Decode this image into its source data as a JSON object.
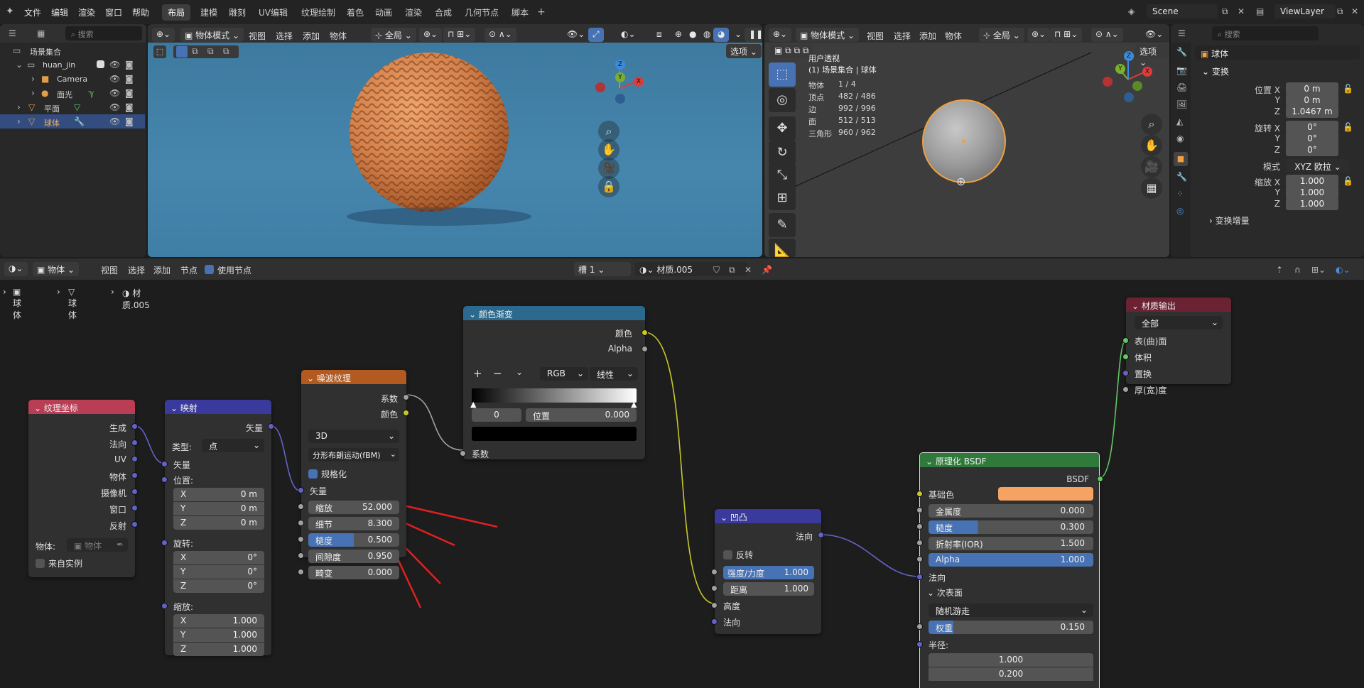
{
  "topbar": {
    "menus": [
      "文件",
      "编辑",
      "渲染",
      "窗口",
      "帮助"
    ],
    "workspaces": [
      "布局",
      "建模",
      "雕刻",
      "UV编辑",
      "纹理绘制",
      "着色",
      "动画",
      "渲染",
      "合成",
      "几何节点",
      "脚本"
    ],
    "scene": "Scene",
    "view_layer": "ViewLayer"
  },
  "outliner": {
    "search_placeholder": "搜索",
    "items": [
      {
        "label": "场景集合"
      },
      {
        "label": "huan_jin"
      },
      {
        "label": "Camera"
      },
      {
        "label": "面光"
      },
      {
        "label": "平面"
      },
      {
        "label": "球体"
      }
    ]
  },
  "viewport1": {
    "mode": "物体模式",
    "menus": [
      "视图",
      "选择",
      "添加",
      "物体"
    ],
    "transform": "全局",
    "options": "选项"
  },
  "viewport2": {
    "mode": "物体模式",
    "menus": [
      "视图",
      "选择",
      "添加",
      "物体"
    ],
    "transform": "全局",
    "options": "选项",
    "overlay_title": "用户透视",
    "overlay_sub": "(1) 场景集合 | 球体",
    "stats": [
      {
        "k": "物体",
        "v": "1 / 4"
      },
      {
        "k": "顶点",
        "v": "482 / 486"
      },
      {
        "k": "边",
        "v": "992 / 996"
      },
      {
        "k": "面",
        "v": "512 / 513"
      },
      {
        "k": "三角形",
        "v": "960 / 962"
      }
    ]
  },
  "gizmo": {
    "x": "X",
    "y": "Y",
    "z": "Z"
  },
  "properties": {
    "search_placeholder": "搜索",
    "object_name": "球体",
    "section": "变换",
    "loc_label": "位置 X",
    "y": "Y",
    "z": "Z",
    "loc": [
      "0 m",
      "0 m",
      "1.0467 m"
    ],
    "rot_label": "旋转 X",
    "rot": [
      "0°",
      "0°",
      "0°"
    ],
    "mode_label": "模式",
    "mode_value": "XYZ 欧拉",
    "scale_label": "缩放 X",
    "scale": [
      "1.000",
      "1.000",
      "1.000"
    ],
    "delta": "变换增量"
  },
  "node_header": {
    "type": "物体",
    "menus": [
      "视图",
      "选择",
      "添加",
      "节点"
    ],
    "use_nodes": "使用节点",
    "slot": "槽 1",
    "material": "材质.005"
  },
  "breadcrumb": [
    "球体",
    "球体",
    "材质.005"
  ],
  "nodes": {
    "texcoord": {
      "title": "纹理坐标",
      "outputs": [
        "生成",
        "法向",
        "UV",
        "物体",
        "摄像机",
        "窗口",
        "反射"
      ],
      "object_label": "物体:",
      "object_ph": "物体",
      "from_instancer": "来自实例"
    },
    "mapping": {
      "title": "映射",
      "out": "矢量",
      "type_label": "类型:",
      "type_value": "点",
      "vector": "矢量",
      "loc": "位置:",
      "rot": "旋转:",
      "scale": "缩放:",
      "x": "X",
      "y": "Y",
      "z": "Z",
      "loc_vals": [
        "0 m",
        "0 m",
        "0 m"
      ],
      "rot_vals": [
        "0°",
        "0°",
        "0°"
      ],
      "scale_vals": [
        "1.000",
        "1.000",
        "1.000"
      ]
    },
    "noise": {
      "title": "噪波纹理",
      "out1": "系数",
      "out2": "颜色",
      "dims": "3D",
      "type": "分形布朗运动(fBM)",
      "normalize": "规格化",
      "vector": "矢量",
      "fields": [
        {
          "k": "缩放",
          "v": "52.000"
        },
        {
          "k": "细节",
          "v": "8.300"
        },
        {
          "k": "糙度",
          "v": "0.500"
        },
        {
          "k": "间隙度",
          "v": "0.950"
        },
        {
          "k": "畸变",
          "v": "0.000"
        }
      ]
    },
    "ramp": {
      "title": "颜色渐变",
      "out1": "颜色",
      "out2": "Alpha",
      "plus": "+",
      "minus": "−",
      "mode": "RGB",
      "interp": "线性",
      "index": "0",
      "pos_label": "位置",
      "pos": "0.000",
      "in": "系数"
    },
    "bump": {
      "title": "凹凸",
      "out": "法向",
      "invert": "反转",
      "strength_k": "强度/力度",
      "strength": "1.000",
      "distance_k": "距离",
      "distance": "1.000",
      "height": "高度",
      "normal": "法向"
    },
    "bsdf": {
      "title": "原理化 BSDF",
      "out": "BSDF",
      "base": "基础色",
      "metal_k": "金属度",
      "metal": "0.000",
      "rough_k": "糙度",
      "rough": "0.300",
      "ior_k": "折射率(IOR)",
      "ior": "1.500",
      "alpha_k": "Alpha",
      "alpha": "1.000",
      "normal": "法向",
      "subsurface": "次表面",
      "method": "随机游走",
      "weight_k": "权重",
      "weight": "0.150",
      "radius": "半径:",
      "r1": "1.000",
      "r2": "0.200"
    },
    "output": {
      "title": "材质输出",
      "target": "全部",
      "inputs": [
        "表(曲)面",
        "体积",
        "置换",
        "厚(宽)度"
      ]
    }
  },
  "colors": {
    "base_color": "#f5a263",
    "sphere": "#d4804a",
    "accent": "#4772b3",
    "arrow": "#e02020"
  }
}
